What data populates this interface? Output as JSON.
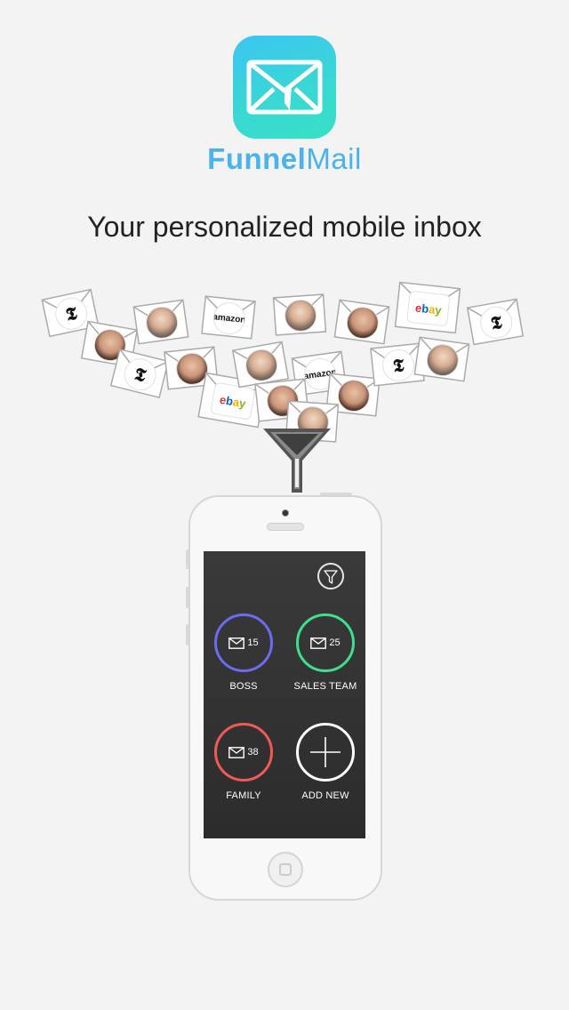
{
  "brand": {
    "part1": "Funnel",
    "part2": "Mail"
  },
  "tagline": "Your personalized mobile inbox",
  "envelopes": {
    "nyt_glyph": "𝕿",
    "amazon": "amazon",
    "ebay": [
      "e",
      "b",
      "a",
      "y"
    ]
  },
  "app": {
    "filter_icon": "funnel-icon",
    "groups": [
      {
        "label": "BOSS",
        "count": "15",
        "color": "#6c6cf0"
      },
      {
        "label": "SALES TEAM",
        "count": "25",
        "color": "#3ee08f"
      },
      {
        "label": "FAMILY",
        "count": "38",
        "color": "#f05a55"
      },
      {
        "label": "ADD NEW",
        "count": "",
        "color": "#ffffff"
      }
    ]
  },
  "colors": {
    "brand_blue": "#4bb3ec",
    "icon_gradient_start": "#3cc5f2",
    "icon_gradient_end": "#36e0c4",
    "background": "#f3f3f3"
  }
}
